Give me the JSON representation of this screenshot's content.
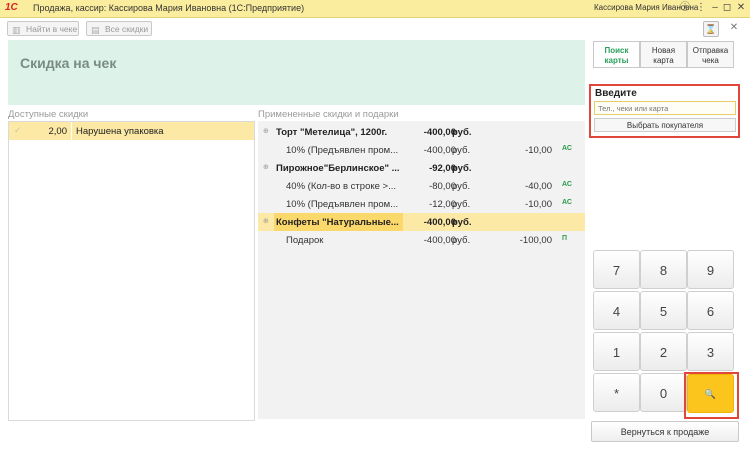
{
  "window": {
    "logo": "1С",
    "title": "Продажа, кассир: Кассирова Мария Ивановна  (1С:Предприятие)",
    "user": "Кассирова Мария Ивановна",
    "info_icon": "info-icon",
    "menu_icon": "menu-icon",
    "minimize_icon": "minimize-icon",
    "maximize_icon": "maximize-icon",
    "close_icon": "close-icon"
  },
  "toolbar": {
    "find_label": "Найти в чеке",
    "all_discounts_label": "Все скидки"
  },
  "banner": {
    "title": "Скидка на чек"
  },
  "available": {
    "label": "Доступные скидки",
    "items": [
      {
        "value": "2,00",
        "name": "Нарушена упаковка"
      }
    ]
  },
  "applied": {
    "label": "Примененные скидки и подарки",
    "rows": [
      {
        "name": "Торт \"Метелица\", 1200г.",
        "amount": "-400,00",
        "currency": "руб.",
        "discount": "",
        "badge": ""
      },
      {
        "name": "10% (Предъявлен пром...",
        "amount": "-400,00",
        "currency": "руб.",
        "discount": "-10,00",
        "badge": "АС"
      },
      {
        "name": "Пирожное\"Берлинское\" ...",
        "amount": "-92,00",
        "currency": "руб.",
        "discount": "",
        "badge": ""
      },
      {
        "name": "40% (Кол-во в строке >...",
        "amount": "-80,00",
        "currency": "руб.",
        "discount": "-40,00",
        "badge": "АС"
      },
      {
        "name": "10% (Предъявлен пром...",
        "amount": "-12,00",
        "currency": "руб.",
        "discount": "-10,00",
        "badge": "АС"
      },
      {
        "name": "Конфеты \"Натуральные...",
        "amount": "-400,00",
        "currency": "руб.",
        "discount": "",
        "badge": ""
      },
      {
        "name": "Подарок",
        "amount": "-400,00",
        "currency": "руб.",
        "discount": "-100,00",
        "badge": "П"
      }
    ]
  },
  "side": {
    "tabs": [
      "Поиск карты",
      "Новая карта",
      "Отправка чека"
    ],
    "enter_label": "Введите",
    "search_placeholder": "Тел., чеки или карта",
    "select_customer": "Выбрать покупателя",
    "keys": [
      "7",
      "8",
      "9",
      "4",
      "5",
      "6",
      "1",
      "2",
      "3",
      "*",
      "0"
    ],
    "search_key": "🔍",
    "back_label": "Вернуться к продаже"
  },
  "colors": {
    "accent": "#fbc51e",
    "highlight": "#fde9a6",
    "banner": "#ddf3ea",
    "frame": "#e0463a",
    "badge": "#2a9a4a"
  }
}
